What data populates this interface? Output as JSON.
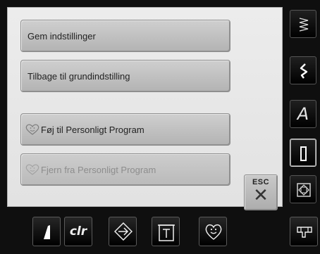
{
  "menu": {
    "save_settings": "Gem indstillinger",
    "reset_defaults": "Tilbage til grundindstilling",
    "add_personal": "Føj til Personligt Program",
    "remove_personal": "Fjern fra Personligt Program"
  },
  "esc_button": {
    "label": "ESC"
  },
  "sidebar": {
    "items": [
      {
        "icon": "zigzag-stitch-icon"
      },
      {
        "icon": "decorative-stitch-icon"
      },
      {
        "icon": "alphabet-icon",
        "glyph": "A"
      },
      {
        "icon": "buttonhole-icon",
        "active": true
      },
      {
        "icon": "quilt-icon"
      },
      {
        "icon": "presser-foot-icon"
      }
    ]
  },
  "bottombar": {
    "items": [
      {
        "icon": "needle-position-icon"
      },
      {
        "icon": "clear-icon",
        "label": "clr"
      },
      {
        "icon": "settings-icon"
      },
      {
        "icon": "help-icon"
      },
      {
        "icon": "personal-program-icon"
      }
    ]
  },
  "colors": {
    "panel": "#e6e6e6",
    "button": "#c0c0c0",
    "chrome": "#000000"
  }
}
